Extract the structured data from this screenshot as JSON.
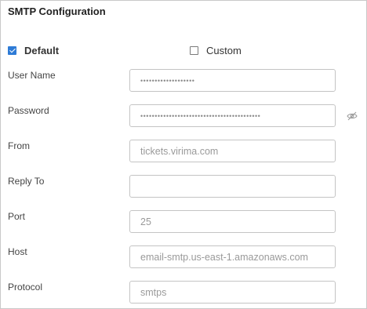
{
  "title": "SMTP Configuration",
  "options": {
    "default_label": "Default",
    "custom_label": "Custom",
    "selected": "Default"
  },
  "fields": {
    "username": {
      "label": "User Name",
      "value": "•••••••••••••••••••"
    },
    "password": {
      "label": "Password",
      "value": "••••••••••••••••••••••••••••••••••••••••••",
      "toggle_icon": "eye-slash-icon"
    },
    "from": {
      "label": "From",
      "value": "tickets.virima.com"
    },
    "reply_to": {
      "label": "Reply To",
      "value": ""
    },
    "port": {
      "label": "Port",
      "value": "25"
    },
    "host": {
      "label": "Host",
      "value": "email-smtp.us-east-1.amazonaws.com"
    },
    "protocol": {
      "label": "Protocol",
      "value": "smtps"
    }
  },
  "colors": {
    "accent": "#2e7bd6",
    "border": "#c4c4c4"
  }
}
